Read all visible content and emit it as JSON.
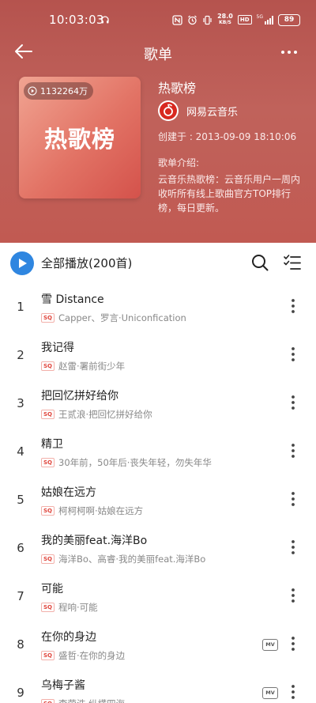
{
  "status_bar": {
    "time": "10:03:03",
    "net_speed": "28.0",
    "net_unit": "KB/S",
    "hd": "HD",
    "signal_label": "5G",
    "battery": "89"
  },
  "nav": {
    "title": "歌单"
  },
  "playlist": {
    "play_count": "1132264万",
    "cover_text": "热歌榜",
    "title": "热歌榜",
    "creator": "网易云音乐",
    "created": "创建于 : 2013-09-09 18:10:06",
    "intro_label": "歌单介绍:",
    "intro": "云音乐热歌榜：云音乐用户一周内收听所有线上歌曲官方TOP排行榜，每日更新。"
  },
  "toolbar": {
    "play_all": "全部播放(200首)"
  },
  "songs": [
    {
      "index": "1",
      "title": "雪 Distance",
      "quality": "SQ",
      "artist": "Capper、罗言·Uniconfication",
      "mv": ""
    },
    {
      "index": "2",
      "title": "我记得",
      "quality": "SQ",
      "artist": "赵雷·署前街少年",
      "mv": ""
    },
    {
      "index": "3",
      "title": "把回忆拼好给你",
      "quality": "SQ",
      "artist": "王贰浪·把回忆拼好给你",
      "mv": ""
    },
    {
      "index": "4",
      "title": "精卫",
      "quality": "SQ",
      "artist": "30年前，50年后·丧失年轻，勿失年华",
      "mv": ""
    },
    {
      "index": "5",
      "title": "姑娘在远方",
      "quality": "SQ",
      "artist": "柯柯柯啊·姑娘在远方",
      "mv": ""
    },
    {
      "index": "6",
      "title": "我的美丽feat.海洋Bo",
      "quality": "SQ",
      "artist": "海洋Bo、高睿·我的美丽feat.海洋Bo",
      "mv": ""
    },
    {
      "index": "7",
      "title": "可能",
      "quality": "SQ",
      "artist": "程响·可能",
      "mv": ""
    },
    {
      "index": "8",
      "title": "在你的身边",
      "quality": "SQ",
      "artist": "盛哲·在你的身边",
      "mv": "MV"
    },
    {
      "index": "9",
      "title": "乌梅子酱",
      "quality": "SQ",
      "artist": "李荣浩·纵横四海",
      "mv": "MV"
    }
  ],
  "colors": {
    "header": "#c0625b",
    "accent_blue": "#2f86e0",
    "sq_red": "#e0453c"
  }
}
